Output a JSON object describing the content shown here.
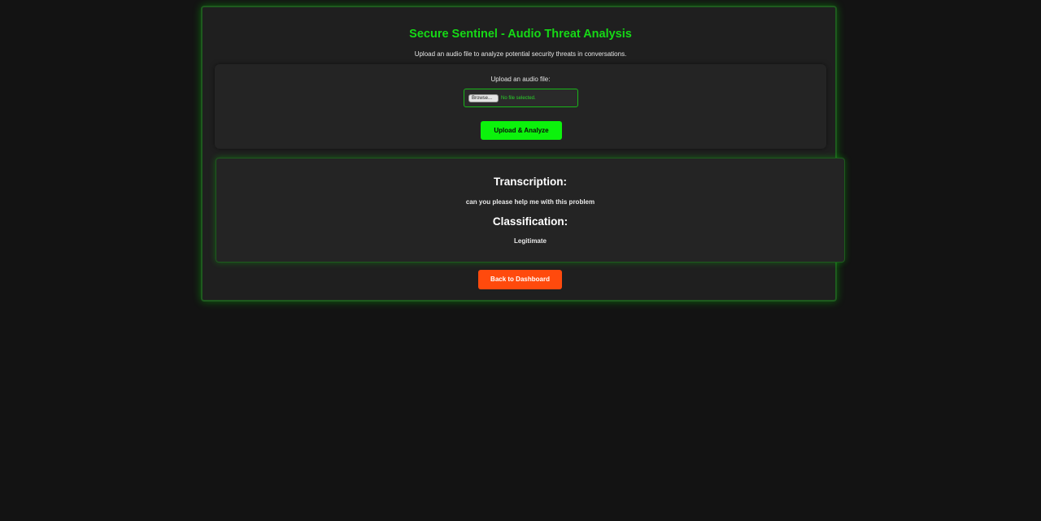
{
  "header": {
    "title": "Secure Sentinel - Audio Threat Analysis",
    "subtitle": "Upload an audio file to analyze potential security threats in conversations."
  },
  "upload": {
    "label": "Upload an audio file:",
    "browse_label": "Browse...",
    "file_status": "No file selected.",
    "submit_label": "Upload & Analyze"
  },
  "results": {
    "transcription_heading": "Transcription:",
    "transcription_text": "can you please help me with this problem",
    "classification_heading": "Classification:",
    "classification_text": "Legitimate"
  },
  "navigation": {
    "back_label": "Back to Dashboard"
  },
  "colors": {
    "accent_green": "#16d916",
    "button_green": "#0cf20c",
    "button_orange": "#ff4a0d",
    "background": "#131313"
  }
}
